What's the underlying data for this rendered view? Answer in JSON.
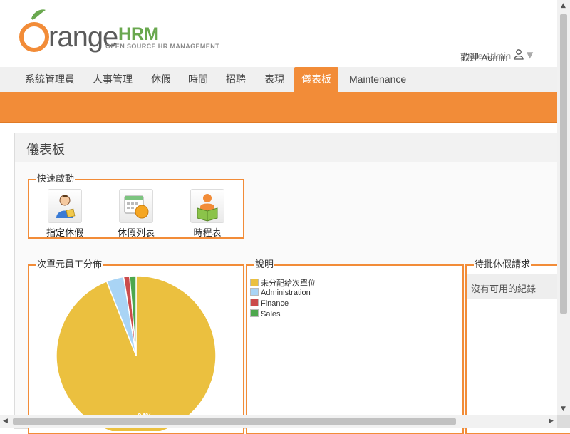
{
  "app": {
    "logo_word": "rangе",
    "logo_hrm": "HRM",
    "tagline": "OPEN SOURCE HR MANAGEMENT",
    "welcome": "歡迎 Admin",
    "welcome_overlay": "Nate Admin",
    "brand_orange": "#f28c38",
    "brand_green": "#6aa84f"
  },
  "nav": {
    "items": [
      {
        "label": "系統管理員"
      },
      {
        "label": "人事管理"
      },
      {
        "label": "休假"
      },
      {
        "label": "時間"
      },
      {
        "label": "招聘"
      },
      {
        "label": "表現"
      },
      {
        "label": "儀表板",
        "active": true
      },
      {
        "label": "Maintenance"
      }
    ]
  },
  "dashboard": {
    "title": "儀表板",
    "quick_launch": {
      "legend": "快速啟動",
      "items": [
        {
          "label": "指定休假",
          "icon": "assign-leave-icon"
        },
        {
          "label": "休假列表",
          "icon": "leave-list-icon"
        },
        {
          "label": "時程表",
          "icon": "timesheet-icon"
        }
      ]
    },
    "distribution": {
      "legend": "次單元員工分佈"
    },
    "legend_box": {
      "legend": "說明"
    },
    "pending_leave": {
      "legend": "待批休假請求",
      "empty_text": "沒有可用的紀錄"
    }
  },
  "chart_data": {
    "type": "pie",
    "title": "",
    "slices": [
      {
        "name": "未分配給次單位",
        "value": 94,
        "color": "#ebc03f"
      },
      {
        "name": "Administration",
        "value": 3.5,
        "color": "#a9d4f5"
      },
      {
        "name": "Finance",
        "value": 1.2,
        "color": "#cb4b4b"
      },
      {
        "name": "Sales",
        "value": 1.3,
        "color": "#4da74d"
      }
    ],
    "data_labels": [
      "94%"
    ],
    "legend_position": "separate-box-right"
  }
}
